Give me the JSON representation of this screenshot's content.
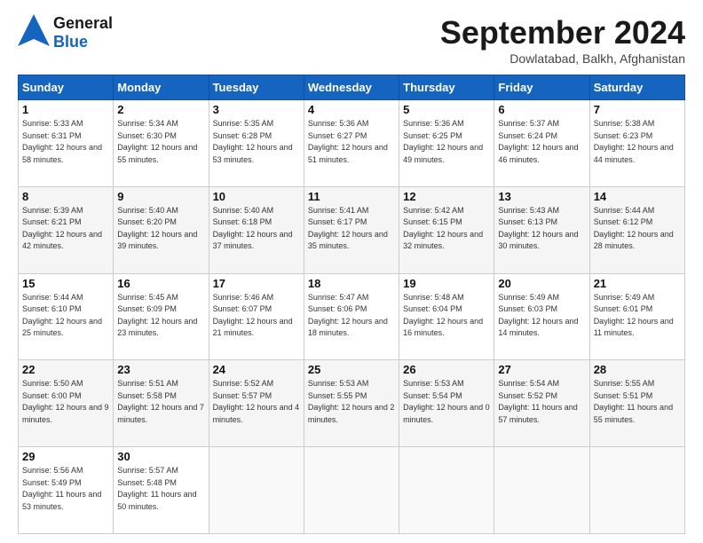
{
  "header": {
    "logo_general": "General",
    "logo_blue": "Blue",
    "month": "September 2024",
    "location": "Dowlatabad, Balkh, Afghanistan"
  },
  "weekdays": [
    "Sunday",
    "Monday",
    "Tuesday",
    "Wednesday",
    "Thursday",
    "Friday",
    "Saturday"
  ],
  "weeks": [
    [
      {
        "day": "1",
        "rise": "5:33 AM",
        "set": "6:31 PM",
        "daylight": "12 hours and 58 minutes."
      },
      {
        "day": "2",
        "rise": "5:34 AM",
        "set": "6:30 PM",
        "daylight": "12 hours and 55 minutes."
      },
      {
        "day": "3",
        "rise": "5:35 AM",
        "set": "6:28 PM",
        "daylight": "12 hours and 53 minutes."
      },
      {
        "day": "4",
        "rise": "5:36 AM",
        "set": "6:27 PM",
        "daylight": "12 hours and 51 minutes."
      },
      {
        "day": "5",
        "rise": "5:36 AM",
        "set": "6:25 PM",
        "daylight": "12 hours and 49 minutes."
      },
      {
        "day": "6",
        "rise": "5:37 AM",
        "set": "6:24 PM",
        "daylight": "12 hours and 46 minutes."
      },
      {
        "day": "7",
        "rise": "5:38 AM",
        "set": "6:23 PM",
        "daylight": "12 hours and 44 minutes."
      }
    ],
    [
      {
        "day": "8",
        "rise": "5:39 AM",
        "set": "6:21 PM",
        "daylight": "12 hours and 42 minutes."
      },
      {
        "day": "9",
        "rise": "5:40 AM",
        "set": "6:20 PM",
        "daylight": "12 hours and 39 minutes."
      },
      {
        "day": "10",
        "rise": "5:40 AM",
        "set": "6:18 PM",
        "daylight": "12 hours and 37 minutes."
      },
      {
        "day": "11",
        "rise": "5:41 AM",
        "set": "6:17 PM",
        "daylight": "12 hours and 35 minutes."
      },
      {
        "day": "12",
        "rise": "5:42 AM",
        "set": "6:15 PM",
        "daylight": "12 hours and 32 minutes."
      },
      {
        "day": "13",
        "rise": "5:43 AM",
        "set": "6:13 PM",
        "daylight": "12 hours and 30 minutes."
      },
      {
        "day": "14",
        "rise": "5:44 AM",
        "set": "6:12 PM",
        "daylight": "12 hours and 28 minutes."
      }
    ],
    [
      {
        "day": "15",
        "rise": "5:44 AM",
        "set": "6:10 PM",
        "daylight": "12 hours and 25 minutes."
      },
      {
        "day": "16",
        "rise": "5:45 AM",
        "set": "6:09 PM",
        "daylight": "12 hours and 23 minutes."
      },
      {
        "day": "17",
        "rise": "5:46 AM",
        "set": "6:07 PM",
        "daylight": "12 hours and 21 minutes."
      },
      {
        "day": "18",
        "rise": "5:47 AM",
        "set": "6:06 PM",
        "daylight": "12 hours and 18 minutes."
      },
      {
        "day": "19",
        "rise": "5:48 AM",
        "set": "6:04 PM",
        "daylight": "12 hours and 16 minutes."
      },
      {
        "day": "20",
        "rise": "5:49 AM",
        "set": "6:03 PM",
        "daylight": "12 hours and 14 minutes."
      },
      {
        "day": "21",
        "rise": "5:49 AM",
        "set": "6:01 PM",
        "daylight": "12 hours and 11 minutes."
      }
    ],
    [
      {
        "day": "22",
        "rise": "5:50 AM",
        "set": "6:00 PM",
        "daylight": "12 hours and 9 minutes."
      },
      {
        "day": "23",
        "rise": "5:51 AM",
        "set": "5:58 PM",
        "daylight": "12 hours and 7 minutes."
      },
      {
        "day": "24",
        "rise": "5:52 AM",
        "set": "5:57 PM",
        "daylight": "12 hours and 4 minutes."
      },
      {
        "day": "25",
        "rise": "5:53 AM",
        "set": "5:55 PM",
        "daylight": "12 hours and 2 minutes."
      },
      {
        "day": "26",
        "rise": "5:53 AM",
        "set": "5:54 PM",
        "daylight": "12 hours and 0 minutes."
      },
      {
        "day": "27",
        "rise": "5:54 AM",
        "set": "5:52 PM",
        "daylight": "11 hours and 57 minutes."
      },
      {
        "day": "28",
        "rise": "5:55 AM",
        "set": "5:51 PM",
        "daylight": "11 hours and 55 minutes."
      }
    ],
    [
      {
        "day": "29",
        "rise": "5:56 AM",
        "set": "5:49 PM",
        "daylight": "11 hours and 53 minutes."
      },
      {
        "day": "30",
        "rise": "5:57 AM",
        "set": "5:48 PM",
        "daylight": "11 hours and 50 minutes."
      },
      null,
      null,
      null,
      null,
      null
    ]
  ]
}
